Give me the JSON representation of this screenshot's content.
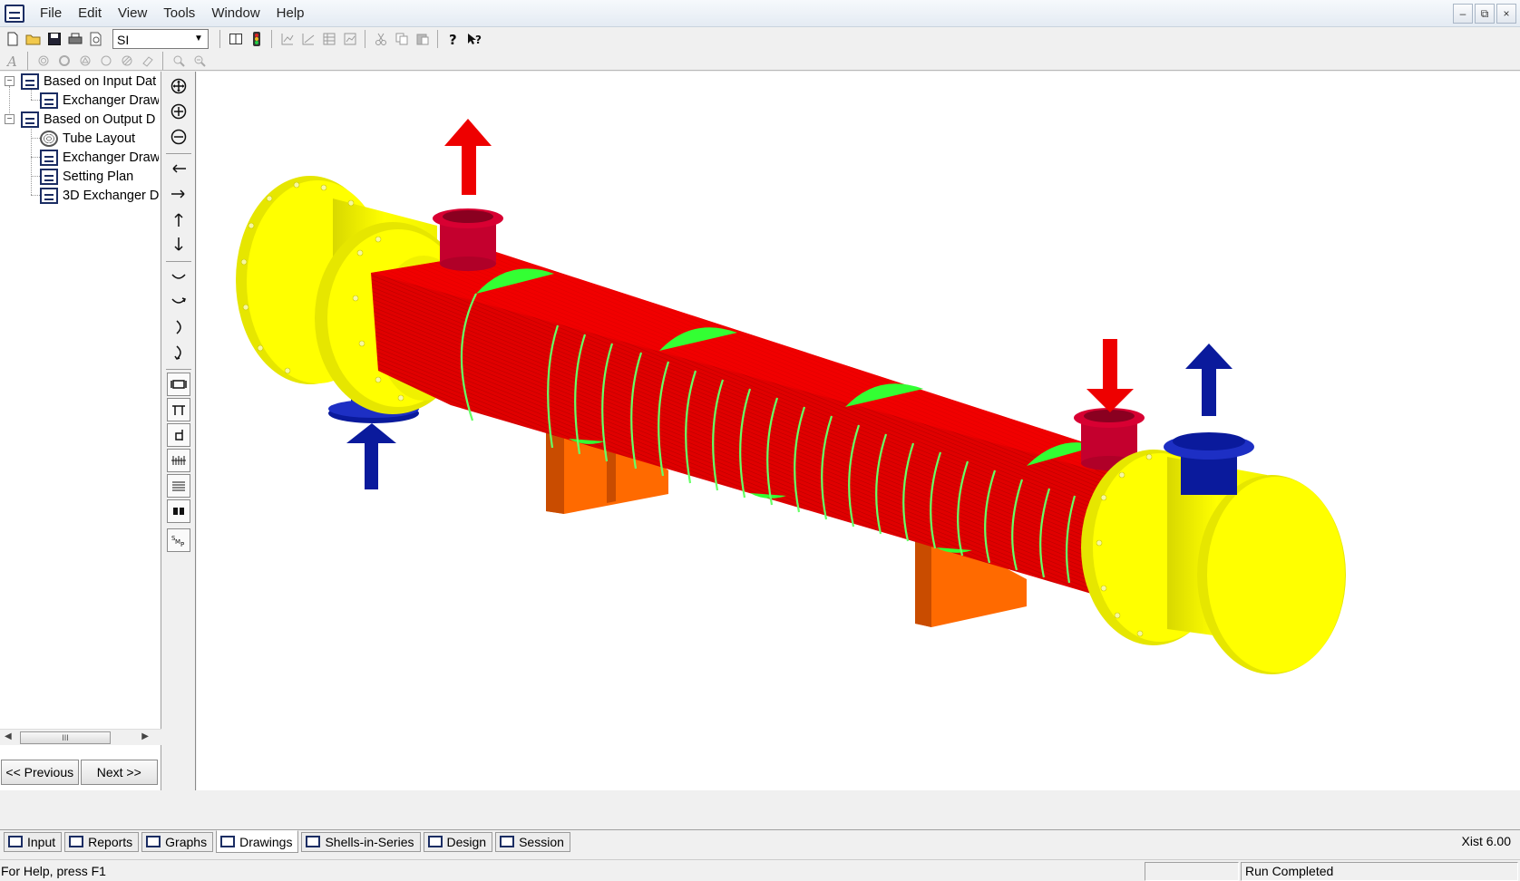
{
  "menu": [
    "File",
    "Edit",
    "View",
    "Tools",
    "Window",
    "Help"
  ],
  "window_controls": [
    "–",
    "⧉",
    "×"
  ],
  "toolbar": {
    "units_select": "SI",
    "caret": "▼"
  },
  "tree": {
    "items": [
      {
        "label": "Based on Input Dat",
        "expander": "−"
      },
      {
        "label": "Exchanger Draw"
      },
      {
        "label": "Based on Output D",
        "expander": "−"
      },
      {
        "label": "Tube Layout"
      },
      {
        "label": "Exchanger Draw"
      },
      {
        "label": "Setting Plan"
      },
      {
        "label": "3D Exchanger D"
      }
    ],
    "scroll_left": "◀",
    "scroll_right": "▶",
    "scroll_thumb": "III"
  },
  "nav": {
    "previous": "<< Previous",
    "next": "Next >>"
  },
  "tabs": [
    {
      "label": "Input",
      "active": false
    },
    {
      "label": "Reports",
      "active": false
    },
    {
      "label": "Graphs",
      "active": false
    },
    {
      "label": "Drawings",
      "active": true
    },
    {
      "label": "Shells-in-Series",
      "active": false
    },
    {
      "label": "Design",
      "active": false
    },
    {
      "label": "Session",
      "active": false
    }
  ],
  "version": "Xist 6.00",
  "status": {
    "help": "For Help, press F1",
    "run_state": "Run Completed"
  },
  "colors": {
    "shell": "#e00000",
    "heads": "#ffff00",
    "baffles": "#33ff33",
    "hot_nozzles": "#d80032",
    "cold_nozzles": "#0a1a9c",
    "supports": "#ff6a00"
  }
}
